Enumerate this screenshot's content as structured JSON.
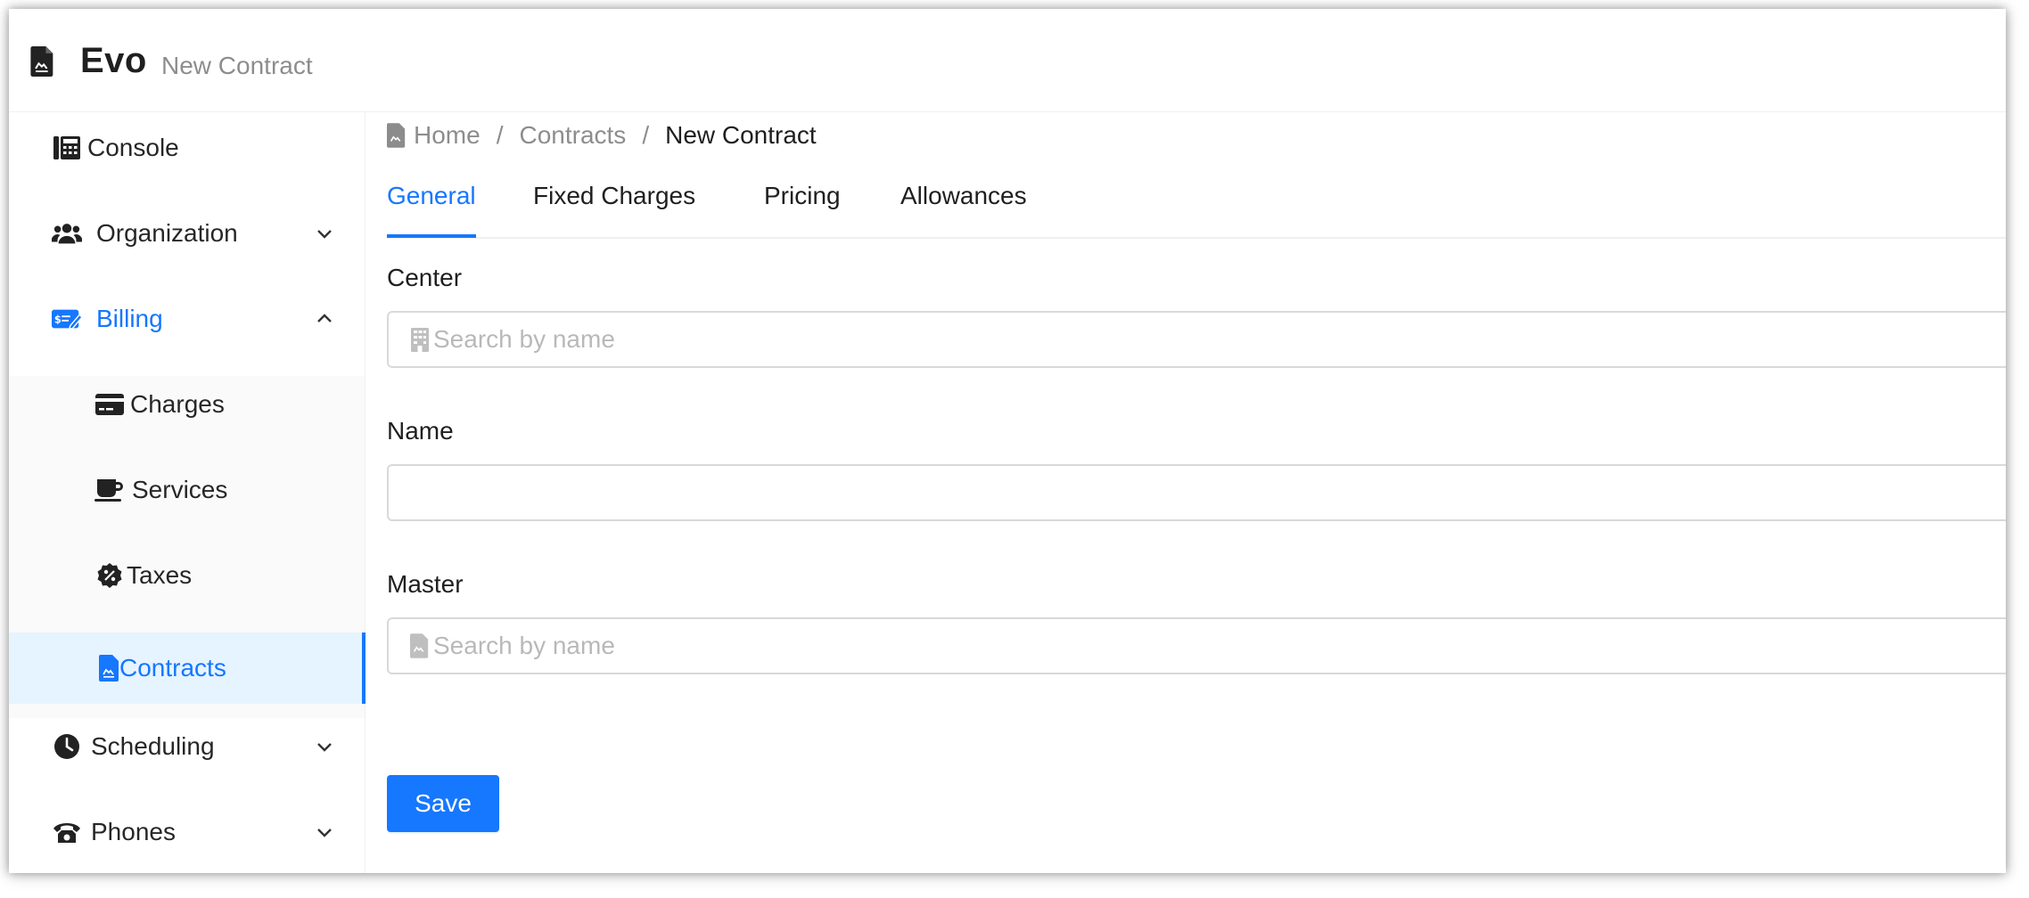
{
  "app": {
    "title": "Evo",
    "subtitle": "New Contract"
  },
  "sidebar": {
    "items": [
      {
        "label": "Console",
        "icon": "console-icon"
      },
      {
        "label": "Organization",
        "icon": "users-icon",
        "expandable": true
      },
      {
        "label": "Billing",
        "icon": "billing-icon",
        "expanded": true
      },
      {
        "label": "Charges",
        "icon": "credit-card-icon"
      },
      {
        "label": "Services",
        "icon": "coffee-icon"
      },
      {
        "label": "Taxes",
        "icon": "percent-badge-icon"
      },
      {
        "label": "Contracts",
        "icon": "contract-file-icon",
        "selected": true
      },
      {
        "label": "Scheduling",
        "icon": "clock-icon",
        "expandable": true
      },
      {
        "label": "Phones",
        "icon": "phone-icon",
        "expandable": true
      }
    ]
  },
  "breadcrumb": {
    "home": "Home",
    "contracts": "Contracts",
    "current": "New Contract",
    "separator": "/"
  },
  "tabs": [
    {
      "label": "General",
      "active": true
    },
    {
      "label": "Fixed Charges"
    },
    {
      "label": "Pricing"
    },
    {
      "label": "Allowances"
    }
  ],
  "form": {
    "center": {
      "label": "Center",
      "placeholder": "Search by name",
      "value": ""
    },
    "name": {
      "label": "Name",
      "placeholder": "",
      "value": ""
    },
    "master": {
      "label": "Master",
      "placeholder": "Search by name",
      "value": ""
    },
    "save_label": "Save"
  },
  "colors": {
    "accent": "#1677ff",
    "selected_bg": "#e6f4ff",
    "submenu_bg": "#fafafa"
  }
}
